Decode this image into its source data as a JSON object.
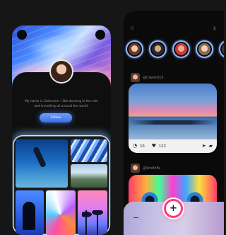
{
  "profile": {
    "bio": "My name is Catherine. I like dancing in the rain and travelling all around the world.",
    "follow_label": "Follow"
  },
  "gallery": {
    "tiles": [
      "diver",
      "blue-stripes",
      "mountain-road",
      "silhouette",
      "colorful-feather",
      "palm-sunset"
    ]
  },
  "feed": {
    "stories": [
      "story-1",
      "story-2",
      "story-3",
      "story-4"
    ],
    "posts": [
      {
        "handle": "@ClaireD15",
        "likes": "10",
        "comments": "122"
      },
      {
        "handle": "@SmithFa"
      }
    ]
  },
  "tabbar": {
    "add_label": "+",
    "minus_label": "−"
  },
  "colors": {
    "accent": "#3c6fe3",
    "fab_ring": "#ff3c78",
    "glow": "#cfe7ff"
  }
}
